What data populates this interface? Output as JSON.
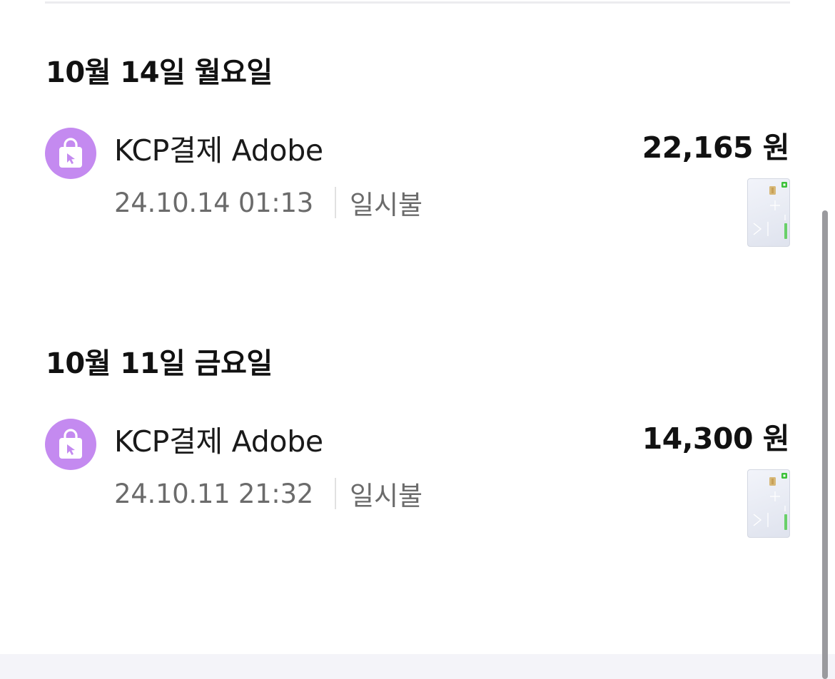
{
  "days": [
    {
      "heading": "10월 14일 월요일",
      "transactions": [
        {
          "merchant": "KCP결제 Adobe",
          "datetime": "24.10.14 01:13",
          "installment": "일시불",
          "amount": "22,165 원"
        }
      ]
    },
    {
      "heading": "10월 11일 금요일",
      "transactions": [
        {
          "merchant": "KCP결제 Adobe",
          "datetime": "24.10.11 21:32",
          "installment": "일시불",
          "amount": "14,300 원"
        }
      ]
    }
  ],
  "icons": {
    "merchant": "shopping-bag-icon",
    "card": "card-thumbnail"
  },
  "colors": {
    "merchant_icon_bg": "#c48af0",
    "card_accent": "#3cc13b",
    "secondary_text": "#6b6b6b"
  }
}
